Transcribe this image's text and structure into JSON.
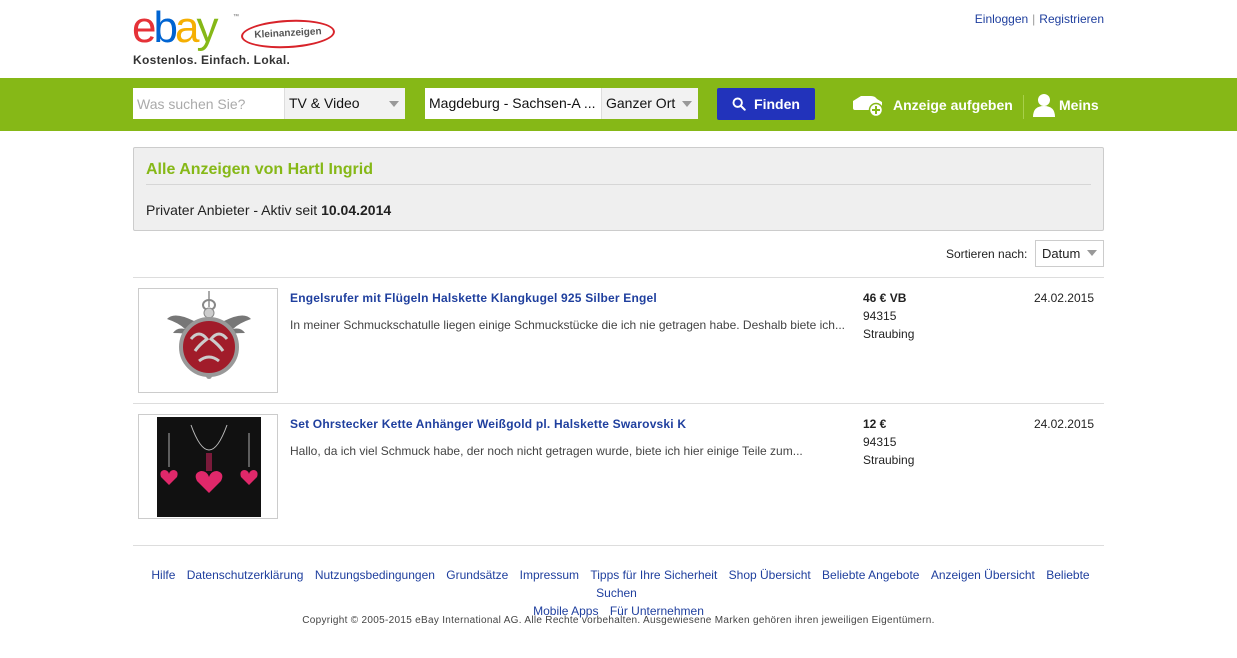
{
  "header": {
    "logo_text": "ebay",
    "logo_badge": "Kleinanzeigen",
    "tagline": "Kostenlos. Einfach. Lokal.",
    "login": "Einloggen",
    "register": "Registrieren",
    "auth_separator": "|"
  },
  "searchbar": {
    "placeholder": "Was suchen Sie?",
    "category": "TV & Video",
    "location": "Magdeburg - Sachsen-A ...",
    "radius": "Ganzer Ort",
    "find_label": "Finden",
    "post_ad_label": "Anzeige aufgeben",
    "account_label": "Meins"
  },
  "seller": {
    "title": "Alle Anzeigen von Hartl Ingrid",
    "info_prefix": "Privater Anbieter - Aktiv seit ",
    "since": "10.04.2014"
  },
  "sort": {
    "label": "Sortieren nach:",
    "value": "Datum"
  },
  "listings": [
    {
      "title": "Engelsrufer mit Flügeln Halskette Klangkugel 925 Silber Engel",
      "description": "In meiner Schmuckschatulle liegen einige Schmuckstücke die ich nie getragen habe. Deshalb biete ich...",
      "price": "46 € VB",
      "zip": "94315",
      "city": "Straubing",
      "date": "24.02.2015",
      "image_icon": "angel-pendant-icon"
    },
    {
      "title": "Set Ohrstecker Kette Anhänger Weißgold pl. Halskette Swarovski K",
      "description": "Hallo, da ich viel Schmuck habe, der noch nicht getragen wurde, biete ich hier einige Teile zum...",
      "price": "12 €",
      "zip": "94315",
      "city": "Straubing",
      "date": "24.02.2015",
      "image_icon": "heart-jewelry-set-icon"
    }
  ],
  "footer": {
    "links": [
      "Hilfe",
      "Datenschutzerklärung",
      "Nutzungsbedingungen",
      "Grundsätze",
      "Impressum",
      "Tipps für Ihre Sicherheit",
      "Shop Übersicht",
      "Beliebte Angebote",
      "Anzeigen Übersicht",
      "Beliebte Suchen",
      "Mobile Apps",
      "Für Unternehmen"
    ],
    "copyright": "Copyright © 2005-2015 eBay International AG. Alle Rechte vorbehalten. Ausgewiesene Marken gehören ihren jeweiligen Eigentümern."
  },
  "colors": {
    "brand_green": "#86b817",
    "button_blue": "#2233bb",
    "link_blue": "#1f3f9e"
  }
}
